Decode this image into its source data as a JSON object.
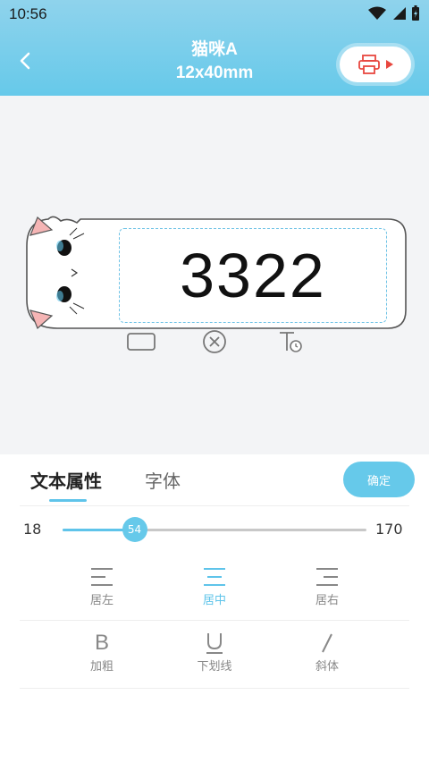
{
  "status": {
    "time": "10:56"
  },
  "header": {
    "title": "猫咪A",
    "subtitle": "12x40mm"
  },
  "label": {
    "text": "3322"
  },
  "tabs": [
    {
      "label": "文本属性"
    },
    {
      "label": "字体"
    }
  ],
  "confirm_label": "确定",
  "slider": {
    "min": "18",
    "max": "170",
    "value": "54",
    "value_num": 54,
    "min_num": 18,
    "max_num": 170
  },
  "alignment": [
    {
      "label": "居左",
      "icon": "align-left-icon",
      "active": false
    },
    {
      "label": "居中",
      "icon": "align-center-icon",
      "active": true
    },
    {
      "label": "居右",
      "icon": "align-right-icon",
      "active": false
    }
  ],
  "styles": [
    {
      "label": "加粗",
      "icon": "bold-icon"
    },
    {
      "label": "下划线",
      "icon": "underline-icon"
    },
    {
      "label": "斜体",
      "icon": "italic-icon"
    }
  ],
  "colors": {
    "accent": "#66c9ea",
    "print_icon": "#e8473f"
  }
}
